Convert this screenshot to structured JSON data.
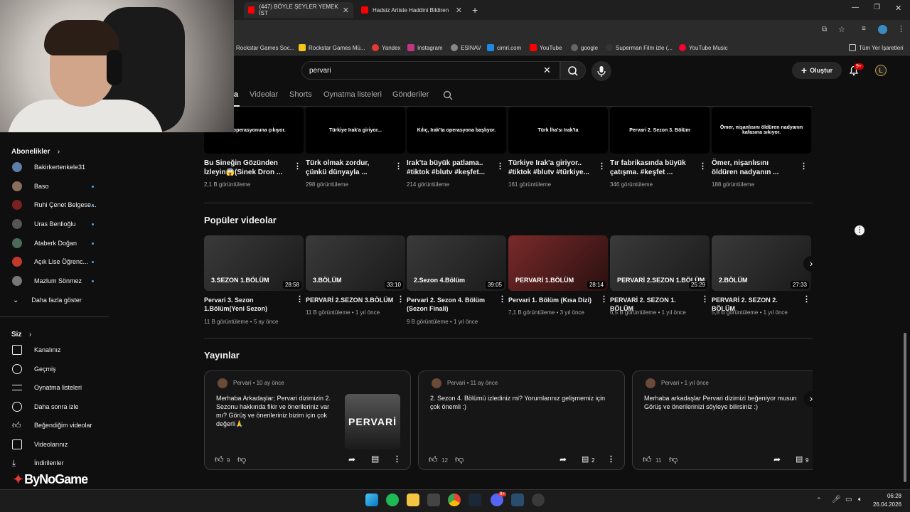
{
  "browser": {
    "tabs": [
      {
        "label": "(447) BÖYLE ŞEYLER YEMEK İST"
      },
      {
        "label": "Hadsiz Artiste Haddini Bildiren"
      }
    ],
    "bookmarks": [
      {
        "label": "Rockstar Games Soc..."
      },
      {
        "label": "Rockstar Games Mü..."
      },
      {
        "label": "Yandex"
      },
      {
        "label": "Instagram"
      },
      {
        "label": "ESINAV"
      },
      {
        "label": "cimri.com"
      },
      {
        "label": "YouTube"
      },
      {
        "label": "google"
      },
      {
        "label": "Superman Film izle (..."
      },
      {
        "label": "YouTube Music"
      },
      {
        "label": "Tüm Yer İşaretleri"
      }
    ]
  },
  "header": {
    "search_value": "pervari",
    "create_label": "Oluştur",
    "notif_badge": "9+",
    "avatar_letter": "L"
  },
  "channel_tabs": {
    "partial": "a",
    "items": [
      "Videolar",
      "Shorts",
      "Oynatma listeleri",
      "Gönderiler"
    ]
  },
  "shorts_row": [
    {
      "thumb_text": "... ik operasyonuna çıkıyor.",
      "title": "Bu Sineğin Gözünden İzleyin😱(Sinek Dron ...",
      "views": "2,1 B görüntüleme"
    },
    {
      "thumb_text": "Türkiye Irak'a giriyor...",
      "title": "Türk olmak zordur, çünkü dünyayla ...",
      "views": "298 görüntüleme"
    },
    {
      "thumb_text": "Kılıç, Irak'ta operasyona başlıyor.",
      "title": "Irak'ta büyük patlama.. #tiktok #blutv #keşfet...",
      "views": "214 görüntüleme"
    },
    {
      "thumb_text": "Türk İha'sı Irak'ta",
      "title": "Türkiye Irak'a giriyor.. #tiktok #blutv #türkiye...",
      "views": "161 görüntüleme"
    },
    {
      "thumb_text": "Pervari 2. Sezon 3. Bölüm",
      "title": "Tır fabrikasında büyük çatışma. #keşfet ...",
      "views": "346 görüntüleme"
    },
    {
      "thumb_text": "Ömer, nişanlısını öldüren nadyanın kafasına sıkıyor.",
      "title": "Ömer, nişanlısını öldüren nadyanın ...",
      "views": "188 görüntüleme"
    }
  ],
  "popular": {
    "title": "Popüler videolar",
    "videos": [
      {
        "thumb_text": "3.SEZON 1.BÖLÜM",
        "duration": "28:58",
        "title": "Pervari 3. Sezon 1.Bölüm(Yeni Sezon)",
        "views": "11 B görüntüleme",
        "age": "5 ay önce"
      },
      {
        "thumb_text": "3.BÖLÜM",
        "duration": "33:10",
        "title": "PERVARİ 2.SEZON 3.BÖLÜM",
        "views": "11 B görüntüleme",
        "age": "1 yıl önce"
      },
      {
        "thumb_text": "2.Sezon 4.Bölüm",
        "duration": "39:05",
        "title": "Pervari 2. Sezon 4. Bölüm (Sezon Finali)",
        "views": "9 B görüntüleme",
        "age": "1 yıl önce"
      },
      {
        "thumb_text": "PERVARİ 1.BÖLÜM",
        "duration": "28:14",
        "title": "Pervari 1. Bölüm (Kısa Dizi)",
        "views": "7,1 B görüntüleme",
        "age": "3 yıl önce"
      },
      {
        "thumb_text": "PERVARİ 2.SEZON 1.BÖLÜM",
        "duration": "25:29",
        "title": "PERVARİ 2. SEZON 1. BÖLÜM",
        "views": "6,5 B görüntüleme",
        "age": "1 yıl önce"
      },
      {
        "thumb_text": "2.BÖLÜM",
        "duration": "27:33",
        "title": "PERVARİ 2. SEZON 2. BÖLÜM",
        "views": "5,8 B görüntüleme",
        "age": "1 yıl önce"
      }
    ]
  },
  "posts": {
    "title": "Yayınlar",
    "items": [
      {
        "author": "Pervari",
        "age": "10 ay önce",
        "text": "Merhaba Arkadaşlar; Pervari dizimizin 2. Sezonu hakkında fikir ve önerileriniz var mı? Görüş ve önerileriniz bizim için çok değerli🙏",
        "likes": "9",
        "comments": "",
        "image_text": "PERVARİ"
      },
      {
        "author": "Pervari",
        "age": "11 ay önce",
        "text": "2. Sezon 4. Bölümü izlediniz mi? Yorumlarınız gelişmemiz için çok önemli :)",
        "likes": "12",
        "comments": "2"
      },
      {
        "author": "Pervari",
        "age": "1 yıl önce",
        "text": "Merhaba arkadaşlar Pervari dizimizi beğeniyor musun Görüş ve önerilerinizi söyleye bilirsiniz :)",
        "likes": "11",
        "comments": "9"
      }
    ]
  },
  "sidebar": {
    "subs_title": "Abonelikler",
    "subs": [
      {
        "label": "Bakirkertenkele31",
        "color": "#5b7fa6",
        "dot": false
      },
      {
        "label": "Baso",
        "color": "#8a6d5a",
        "dot": true
      },
      {
        "label": "Ruhi Çenet Belgese...",
        "color": "#7a2020",
        "dot": true
      },
      {
        "label": "Uras Benlioğlu",
        "color": "#555555",
        "dot": true
      },
      {
        "label": "Ataberk Doğan",
        "color": "#4a6a5a",
        "dot": true
      },
      {
        "label": "Açık Lise Öğrenc...",
        "color": "#c0392b",
        "dot": true
      },
      {
        "label": "Mazlum Sönmez",
        "color": "#777777",
        "dot": true
      }
    ],
    "more_label": "Daha fazla göster",
    "you_title": "Siz",
    "you_items": [
      {
        "label": "Kanalınız",
        "icon": "user-box-icon"
      },
      {
        "label": "Geçmiş",
        "icon": "history-icon"
      },
      {
        "label": "Oynatma listeleri",
        "icon": "playlist-icon"
      },
      {
        "label": "Daha sonra izle",
        "icon": "clock-icon"
      },
      {
        "label": "Beğendiğim videolar",
        "icon": "thumb-up-icon"
      },
      {
        "label": "Videolarınız",
        "icon": "video-icon"
      },
      {
        "label": "İndirilenler",
        "icon": "download-icon"
      }
    ]
  },
  "watermark": "ByNoGame",
  "taskbar": {
    "time": "06:28",
    "date": "26.04.2026",
    "app_badge": "9+"
  },
  "colors": {
    "bg": "#0f0f0f",
    "accent_red": "#ff0000",
    "link_blue": "#3ea6ff"
  }
}
